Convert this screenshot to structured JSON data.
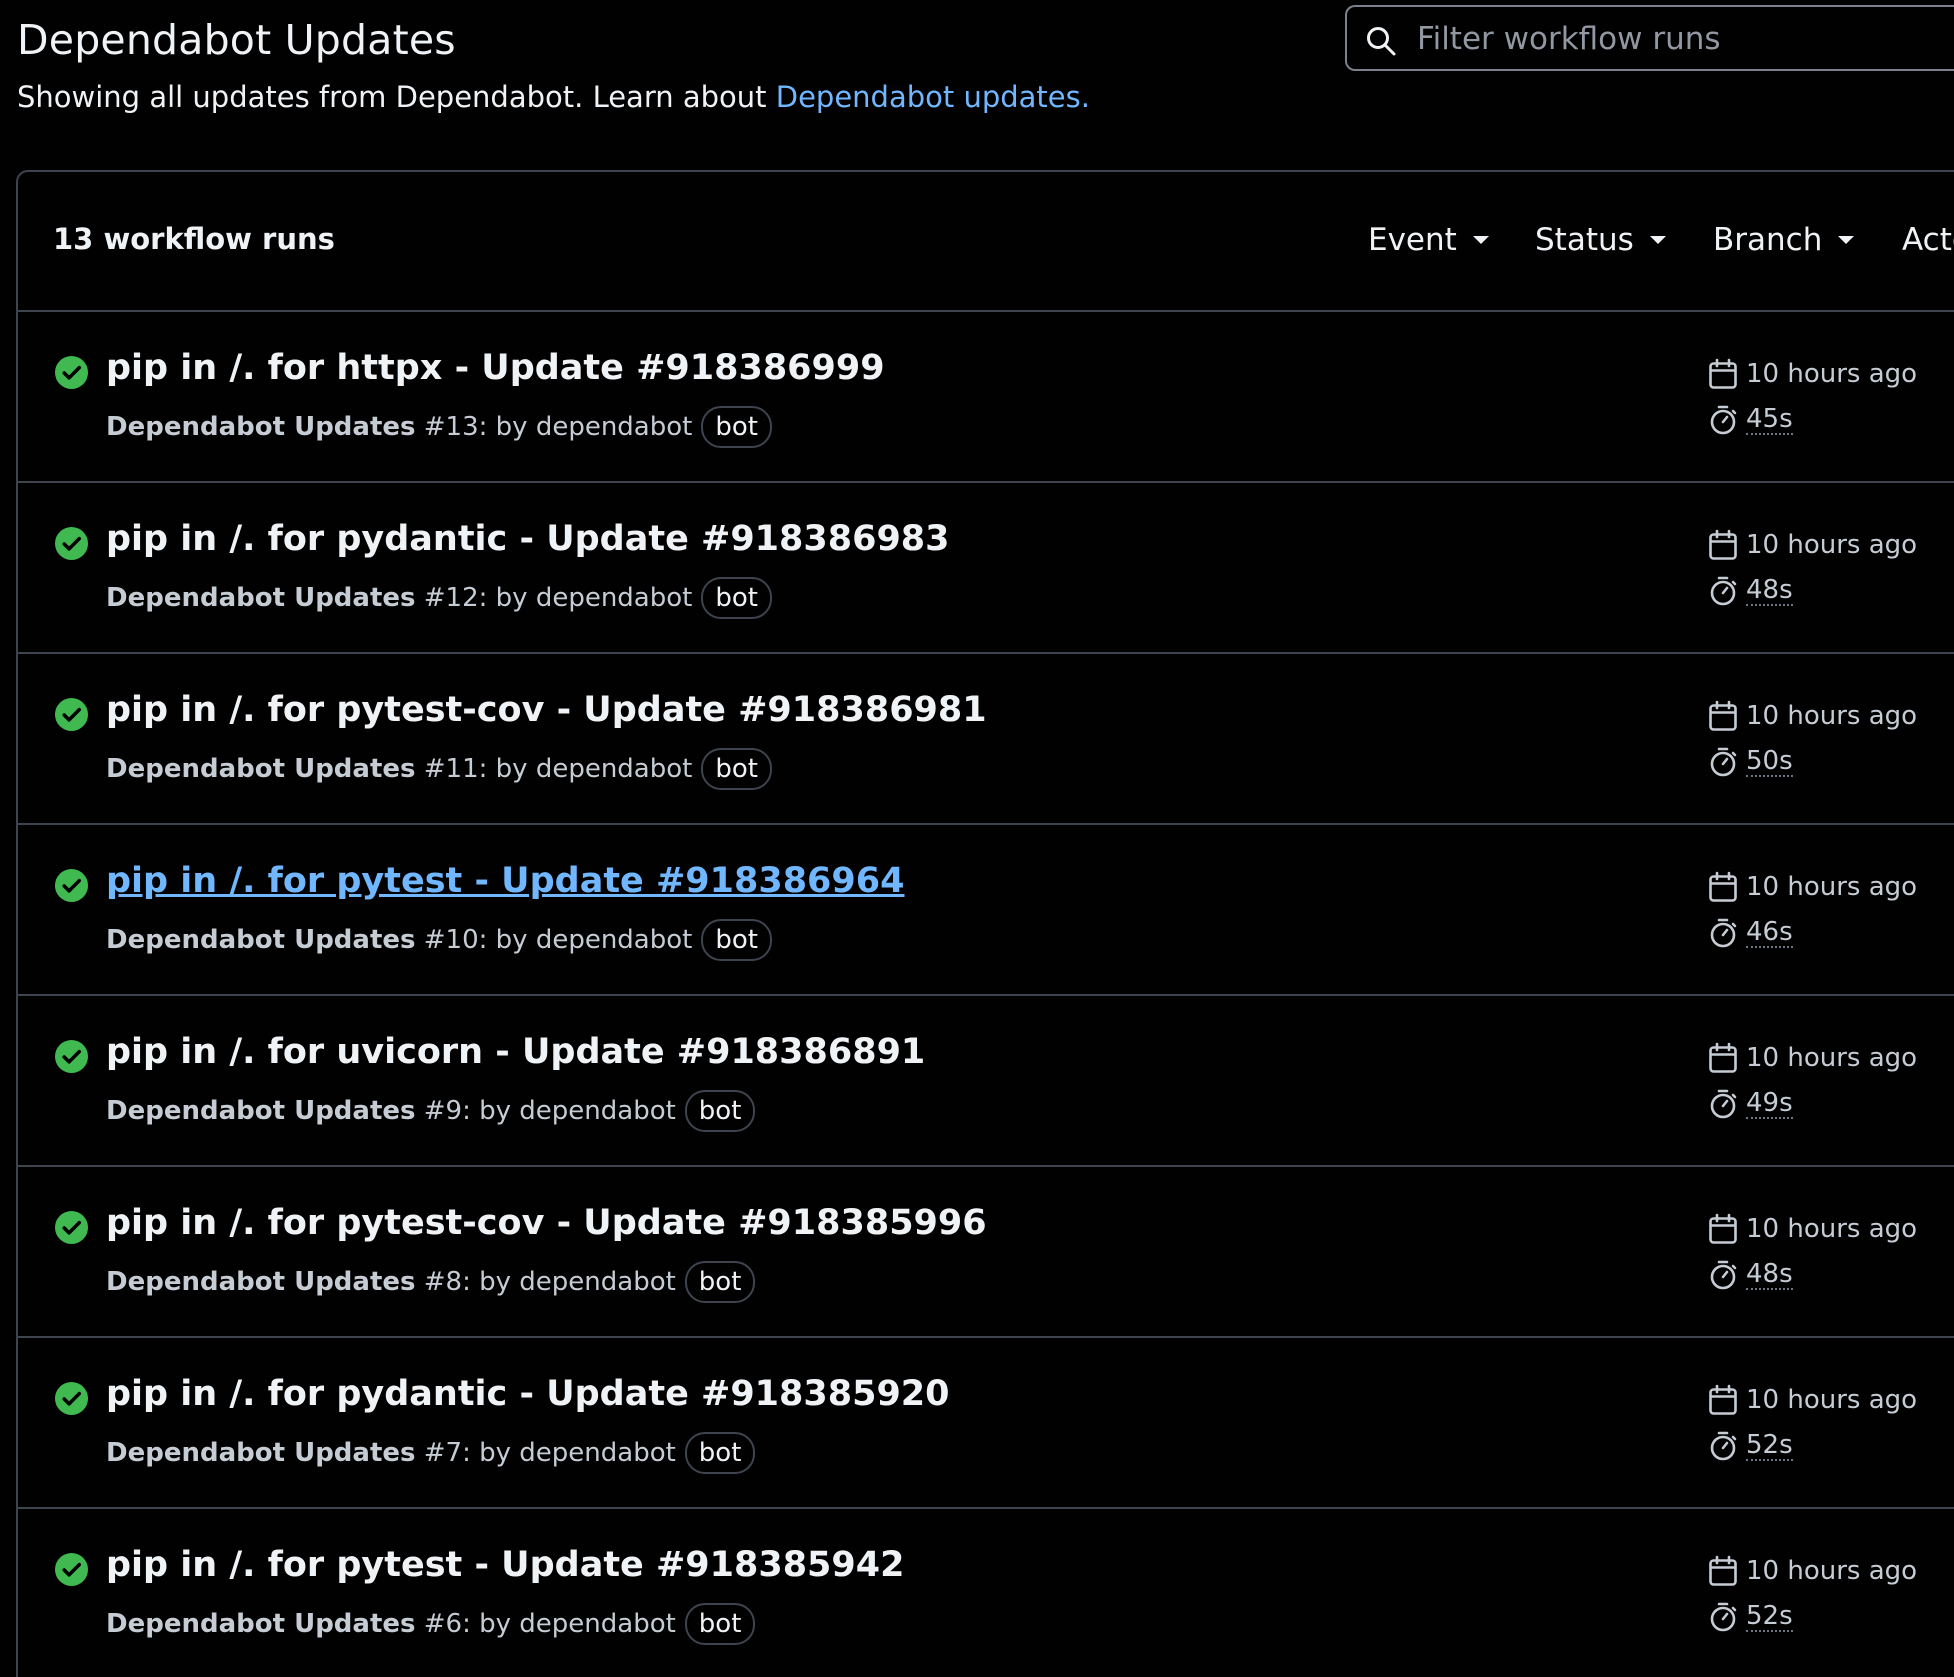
{
  "header": {
    "title": "Dependabot Updates",
    "subtitle_text": "Showing all updates from Dependabot. Learn about ",
    "subtitle_link": "Dependabot updates."
  },
  "search": {
    "placeholder": "Filter workflow runs"
  },
  "list": {
    "count_label": "13 workflow runs",
    "filters": {
      "event": "Event",
      "status": "Status",
      "branch": "Branch",
      "actor": "Actor"
    },
    "runs": [
      {
        "title": "pip in /. for httpx - Update #918386999",
        "workflow": "Dependabot Updates",
        "run_number": "#13: by dependabot",
        "badge": "bot",
        "when": "10 hours ago",
        "duration": "45s",
        "status": "success"
      },
      {
        "title": "pip in /. for pydantic - Update #918386983",
        "workflow": "Dependabot Updates",
        "run_number": "#12: by dependabot",
        "badge": "bot",
        "when": "10 hours ago",
        "duration": "48s",
        "status": "success"
      },
      {
        "title": "pip in /. for pytest-cov - Update #918386981",
        "workflow": "Dependabot Updates",
        "run_number": "#11: by dependabot",
        "badge": "bot",
        "when": "10 hours ago",
        "duration": "50s",
        "status": "success"
      },
      {
        "title": "pip in /. for pytest - Update #918386964",
        "workflow": "Dependabot Updates",
        "run_number": "#10: by dependabot",
        "badge": "bot",
        "when": "10 hours ago",
        "duration": "46s",
        "status": "success"
      },
      {
        "title": "pip in /. for uvicorn - Update #918386891",
        "workflow": "Dependabot Updates",
        "run_number": "#9: by dependabot",
        "badge": "bot",
        "when": "10 hours ago",
        "duration": "49s",
        "status": "success"
      },
      {
        "title": "pip in /. for pytest-cov - Update #918385996",
        "workflow": "Dependabot Updates",
        "run_number": "#8: by dependabot",
        "badge": "bot",
        "when": "10 hours ago",
        "duration": "48s",
        "status": "success"
      },
      {
        "title": "pip in /. for pydantic - Update #918385920",
        "workflow": "Dependabot Updates",
        "run_number": "#7: by dependabot",
        "badge": "bot",
        "when": "10 hours ago",
        "duration": "52s",
        "status": "success"
      },
      {
        "title": "pip in /. for pytest - Update #918385942",
        "workflow": "Dependabot Updates",
        "run_number": "#6: by dependabot",
        "badge": "bot",
        "when": "10 hours ago",
        "duration": "52s",
        "status": "success"
      }
    ]
  },
  "colors": {
    "success": "#3fb950",
    "link": "#71b7ff",
    "border": "#3d444d",
    "background": "#010101"
  }
}
